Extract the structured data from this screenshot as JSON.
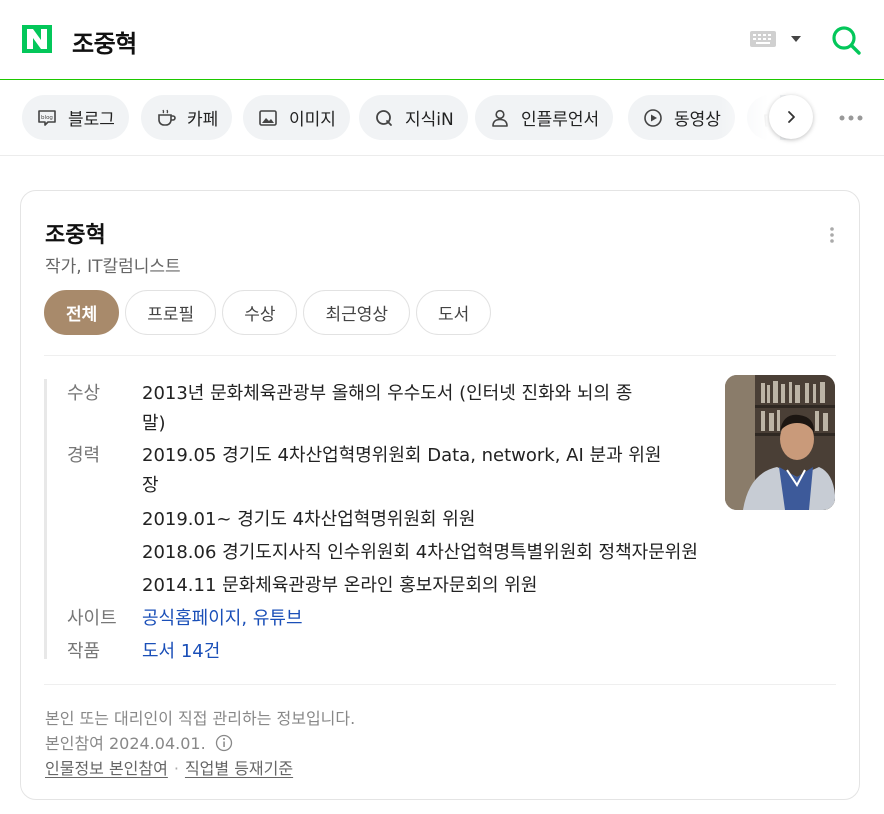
{
  "header": {
    "logo_letter": "N",
    "query": "조중혁"
  },
  "tabs": [
    {
      "label": "블로그",
      "icon": "blog-icon"
    },
    {
      "label": "카페",
      "icon": "cafe-cup-icon"
    },
    {
      "label": "이미지",
      "icon": "image-icon"
    },
    {
      "label": "지식iN",
      "icon": "q-icon"
    },
    {
      "label": "인플루언서",
      "icon": "person-icon"
    },
    {
      "label": "동영상",
      "icon": "play-icon"
    },
    {
      "label": "",
      "icon": "shopping-bag-icon"
    }
  ],
  "profile": {
    "name": "조중혁",
    "occupation": "작가, IT칼럼니스트",
    "subtabs": [
      "전체",
      "프로필",
      "수상",
      "최근영상",
      "도서"
    ],
    "active_subtab": "전체",
    "award_label": "수상",
    "award_line1": "2013년 문화체육관광부 올해의 우수도서 (인터넷 진화와 뇌의 종",
    "award_line2": "말)",
    "career_label": "경력",
    "career_items": [
      {
        "line1": "2019.05 경기도 4차산업혁명위원회 Data, network, AI 분과 위원",
        "line2": "장"
      },
      {
        "line1": "2019.01~ 경기도 4차산업혁명위원회 위원",
        "line2": ""
      },
      {
        "line1": "2018.06 경기도지사직 인수위원회 4차산업혁명특별위원회 정책자문위원",
        "line2": ""
      },
      {
        "line1": "2014.11 문화체육관광부 온라인 홍보자문회의 위원",
        "line2": ""
      }
    ],
    "site_label": "사이트",
    "site_link1": "공식홈페이지",
    "site_sep": ",",
    "site_link2": "유튜브",
    "works_label": "작품",
    "works_value": "도서 14건"
  },
  "footer": {
    "note": "본인 또는 대리인이 직접 관리하는 정보입니다.",
    "date": "본인참여 2024.04.01.",
    "link1": "인물정보 본인참여",
    "sep": "·",
    "link2": "직업별 등재기준"
  },
  "colors": {
    "brand_green": "#03c75a",
    "active_tab": "#a88a6b",
    "link_blue": "#1a4fb8"
  }
}
